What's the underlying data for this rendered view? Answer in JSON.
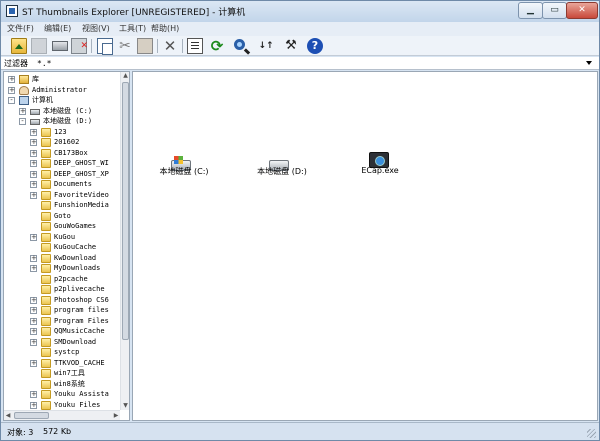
{
  "window": {
    "title": "ST Thumbnails Explorer [UNREGISTERED] - 计算机",
    "min_glyph": "▁",
    "max_glyph": "▭",
    "close_glyph": "✕"
  },
  "menu": [
    "文件(F)",
    "编辑(E)",
    "视图(V)",
    "工具(T)",
    "帮助(H)"
  ],
  "toolbar": {
    "icons": [
      "folder-up-icon",
      "new-folder-icon",
      "drive-icon",
      "delete-icon",
      "copy-icon",
      "cut-icon",
      "paste-icon",
      "cancel-icon",
      "properties-icon",
      "refresh-icon",
      "search-icon",
      "sort-icon",
      "tools-icon",
      "help-icon"
    ],
    "glyphs": {
      "cut": "✂",
      "cancel": "✕",
      "refresh": "⟳",
      "sort": "↓↑",
      "tools": "⚒",
      "help": "?"
    }
  },
  "filter": {
    "label": "过滤器",
    "value": "*.*"
  },
  "tree": {
    "rows": [
      {
        "label": "库",
        "level": 0,
        "expander": "+",
        "icon": "library"
      },
      {
        "label": "Administrator",
        "level": 0,
        "expander": "+",
        "icon": "user"
      },
      {
        "label": "计算机",
        "level": 0,
        "expander": "-",
        "icon": "computer"
      },
      {
        "label": "本地磁盘 (C:)",
        "level": 1,
        "expander": "+",
        "icon": "drive"
      },
      {
        "label": "本地磁盘 (D:)",
        "level": 1,
        "expander": "-",
        "icon": "drive"
      },
      {
        "label": "123",
        "level": 2,
        "expander": "+",
        "icon": "folder"
      },
      {
        "label": "201602",
        "level": 2,
        "expander": "+",
        "icon": "folder"
      },
      {
        "label": "CB173Box",
        "level": 2,
        "expander": "+",
        "icon": "folder"
      },
      {
        "label": "DEEP_GHOST_WI",
        "level": 2,
        "expander": "+",
        "icon": "folder"
      },
      {
        "label": "DEEP_GHOST_XP",
        "level": 2,
        "expander": "+",
        "icon": "folder"
      },
      {
        "label": "Documents",
        "level": 2,
        "expander": "+",
        "icon": "folder"
      },
      {
        "label": "FavoriteVideo",
        "level": 2,
        "expander": "+",
        "icon": "folder"
      },
      {
        "label": "FunshionMedia",
        "level": 2,
        "expander": "",
        "icon": "folder"
      },
      {
        "label": "Goto",
        "level": 2,
        "expander": "",
        "icon": "folder"
      },
      {
        "label": "GouWoGames",
        "level": 2,
        "expander": "",
        "icon": "folder"
      },
      {
        "label": "KuGou",
        "level": 2,
        "expander": "+",
        "icon": "folder"
      },
      {
        "label": "KuGouCache",
        "level": 2,
        "expander": "",
        "icon": "folder"
      },
      {
        "label": "KwDownload",
        "level": 2,
        "expander": "+",
        "icon": "folder"
      },
      {
        "label": "MyDownloads",
        "level": 2,
        "expander": "+",
        "icon": "folder"
      },
      {
        "label": "p2pcache",
        "level": 2,
        "expander": "",
        "icon": "folder"
      },
      {
        "label": "p2plivecache",
        "level": 2,
        "expander": "",
        "icon": "folder"
      },
      {
        "label": "Photoshop CS6",
        "level": 2,
        "expander": "+",
        "icon": "folder"
      },
      {
        "label": "program files",
        "level": 2,
        "expander": "+",
        "icon": "folder"
      },
      {
        "label": "Program Files",
        "level": 2,
        "expander": "+",
        "icon": "folder"
      },
      {
        "label": "QQMusicCache",
        "level": 2,
        "expander": "+",
        "icon": "folder"
      },
      {
        "label": "SMDownload",
        "level": 2,
        "expander": "+",
        "icon": "folder"
      },
      {
        "label": "systcp",
        "level": 2,
        "expander": "",
        "icon": "folder"
      },
      {
        "label": "TTKVOD_CACHE",
        "level": 2,
        "expander": "+",
        "icon": "folder"
      },
      {
        "label": "win7工具",
        "level": 2,
        "expander": "",
        "icon": "folder"
      },
      {
        "label": "win8系统",
        "level": 2,
        "expander": "",
        "icon": "folder"
      },
      {
        "label": "Youku Assista",
        "level": 2,
        "expander": "+",
        "icon": "folder"
      },
      {
        "label": "Youku Files",
        "level": 2,
        "expander": "+",
        "icon": "folder"
      }
    ],
    "scroll": {
      "up": "▲",
      "down": "▼",
      "left": "◀",
      "right": "▶"
    }
  },
  "items": [
    {
      "label": "本地磁盘 (C:)",
      "icon": "system-drive-icon"
    },
    {
      "label": "本地磁盘 (D:)",
      "icon": "drive-icon"
    },
    {
      "label": "ECap.exe",
      "icon": "camera-app-icon"
    }
  ],
  "status": {
    "count": "对象: 3",
    "size": "572 Kb"
  }
}
